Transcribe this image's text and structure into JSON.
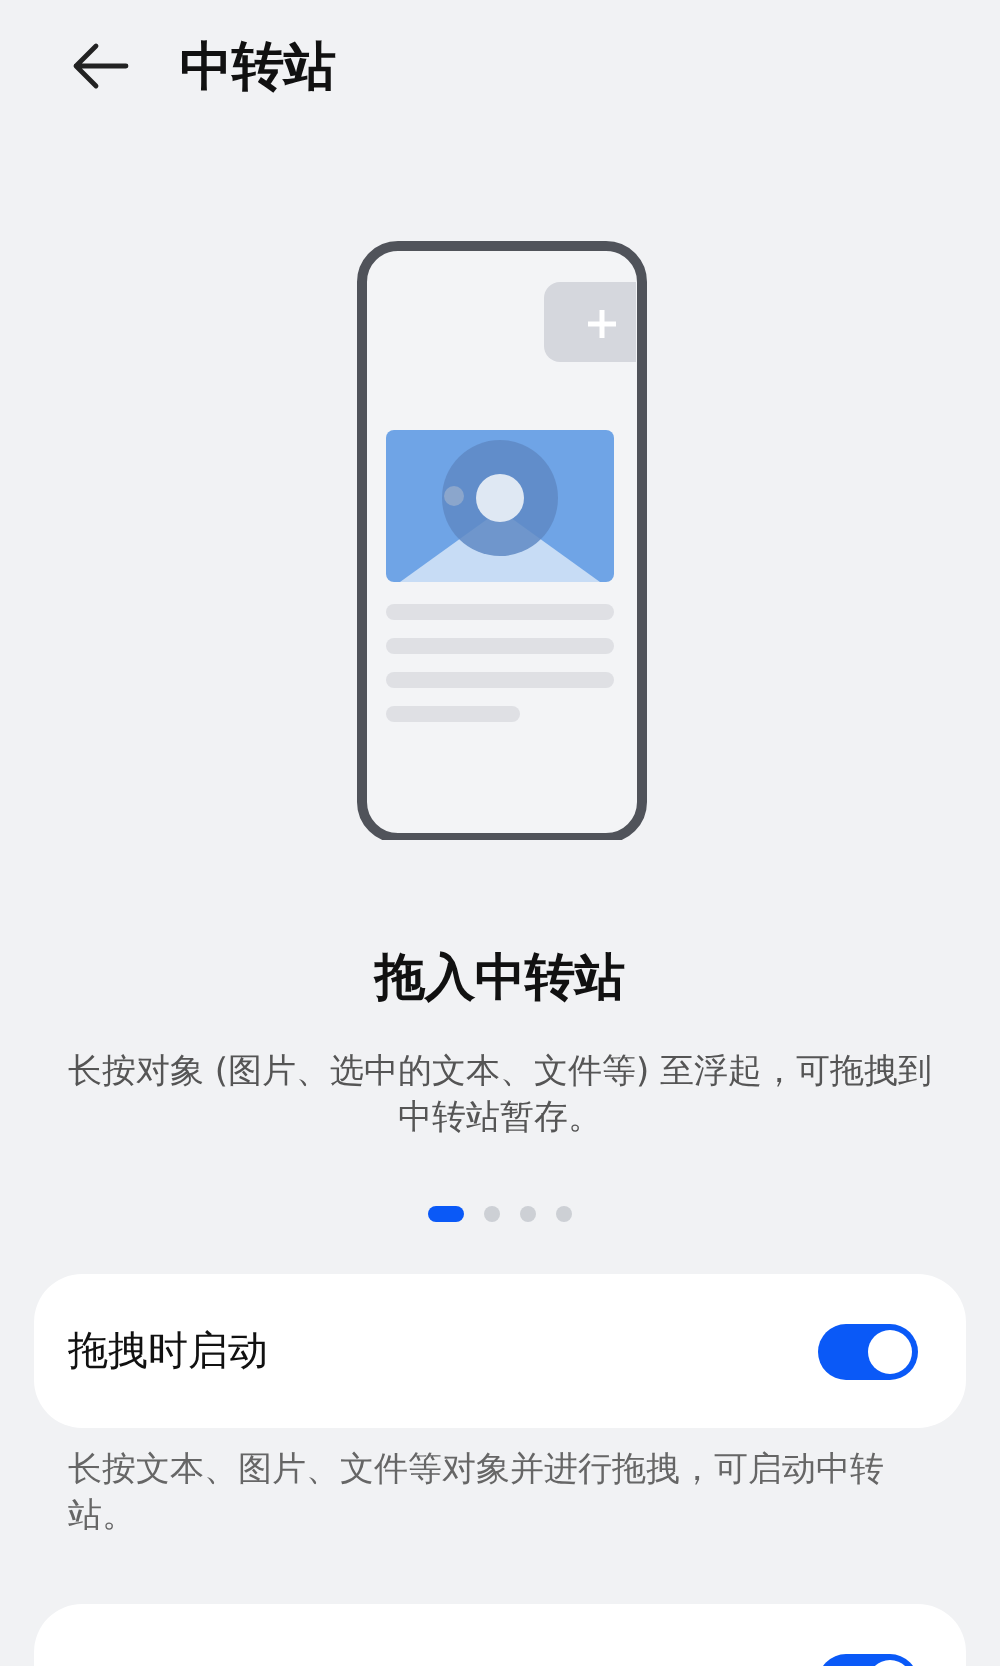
{
  "header": {
    "title": "中转站"
  },
  "onboarding": {
    "title": "拖入中转站",
    "description": "长按对象 (图片、选中的文本、文件等) 至浮起，可拖拽到中转站暂存。",
    "pages": [
      {
        "selected": true
      },
      {
        "selected": false
      },
      {
        "selected": false
      },
      {
        "selected": false
      }
    ]
  },
  "settings": [
    {
      "label": "拖拽时启动",
      "on": true,
      "description": "长按文本、图片、文件等对象并进行拖拽，可启动中转站。"
    },
    {
      "on": true
    }
  ]
}
